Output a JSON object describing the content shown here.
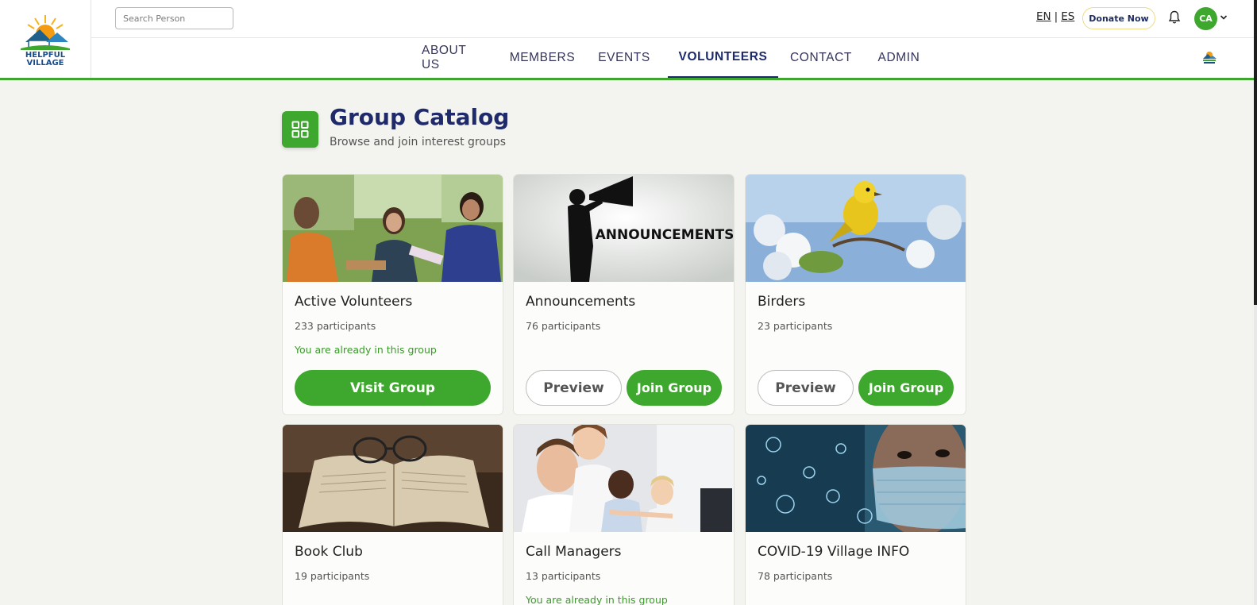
{
  "brand": {
    "logo_line1": "HELPFUL",
    "logo_line2": "VILLAGE"
  },
  "header": {
    "search_placeholder": "Search Person",
    "lang_en": "EN",
    "lang_sep": "|",
    "lang_es": "ES",
    "donate_label": "Donate Now",
    "avatar_initials": "CA"
  },
  "nav": {
    "items": [
      "ABOUT US",
      "MEMBERS",
      "EVENTS",
      "VOLUNTEERS",
      "CONTACT",
      "ADMIN"
    ],
    "active": "VOLUNTEERS"
  },
  "page": {
    "title": "Group Catalog",
    "subtitle": "Browse and join interest groups"
  },
  "groups": [
    {
      "name": "Active Volunteers",
      "participants": "233 participants",
      "member_note": "You are already in this group",
      "visit_label": "Visit Group"
    },
    {
      "name": "Announcements",
      "participants": "76 participants",
      "image_text": "ANNOUNCEMENTS",
      "preview_label": "Preview",
      "join_label": "Join Group"
    },
    {
      "name": "Birders",
      "participants": "23 participants",
      "preview_label": "Preview",
      "join_label": "Join Group"
    },
    {
      "name": "Book Club",
      "participants": "19 participants"
    },
    {
      "name": "Call Managers",
      "participants": "13 participants",
      "member_note": "You are already in this group"
    },
    {
      "name": "COVID-19 Village INFO",
      "participants": "78 participants"
    }
  ],
  "colors": {
    "accent_green": "#3ea72d",
    "navy": "#1f2a6b",
    "background": "#f3f4ef"
  },
  "icons": [
    "grid-icon",
    "bell-icon",
    "chevron-down-icon",
    "helpful-village-logo"
  ]
}
